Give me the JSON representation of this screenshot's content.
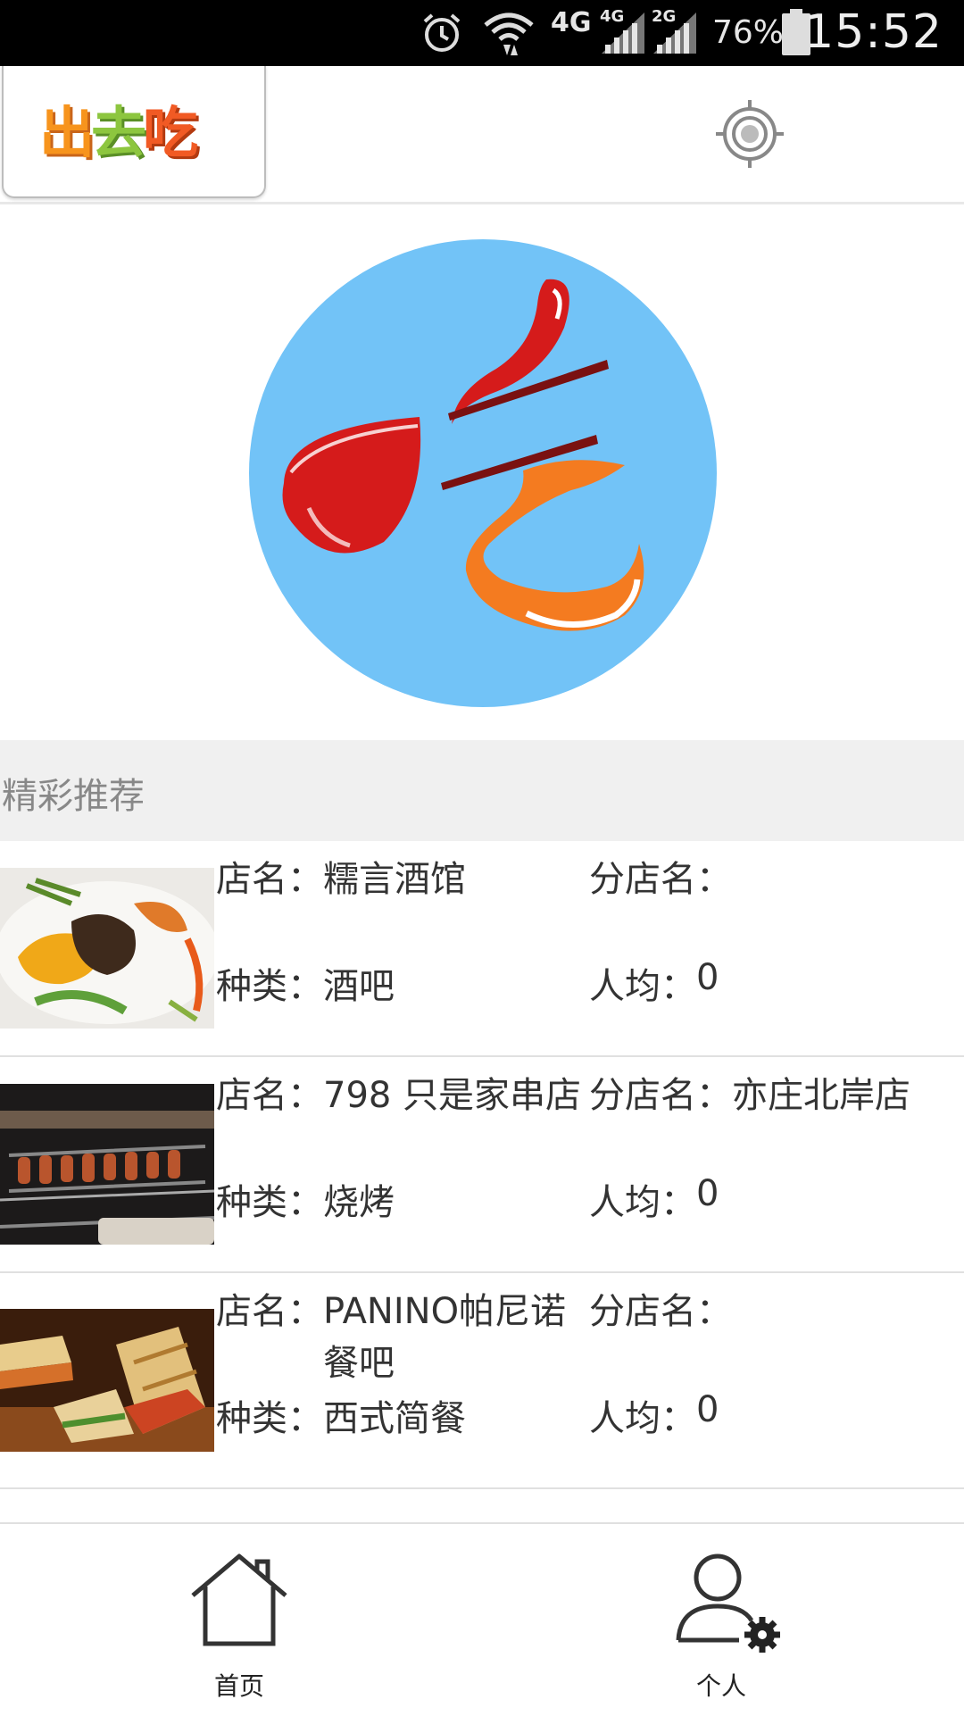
{
  "status_bar": {
    "time": "15:52",
    "battery": "76%",
    "network_1": "4G",
    "network_2": "4G",
    "network_3": "2G",
    "icons": [
      "alarm-icon",
      "wifi-icon",
      "signal-icon",
      "signal-icon",
      "battery-icon"
    ]
  },
  "header": {
    "logo_text": "出去吃",
    "logo_chars": [
      "出",
      "去",
      "吃"
    ],
    "logo_colors": [
      "#f7941d",
      "#8dc63f",
      "#f15a24"
    ],
    "locate_icon": "crosshair-icon"
  },
  "hero": {
    "logo_icon": "chi-logo-icon",
    "circle_color": "#72c3f7"
  },
  "section": {
    "title": "精彩推荐"
  },
  "shops": [
    {
      "name_label": "店名：",
      "name": "糯言酒馆",
      "branch_label": "分店名：",
      "branch": "",
      "category_label": "种类：",
      "category": "酒吧",
      "avg_label": "人均：",
      "avg": "0"
    },
    {
      "name_label": "店名：",
      "name": "798 只是家串店",
      "branch_label": "分店名：",
      "branch": "亦庄北岸店",
      "category_label": "种类：",
      "category": "烧烤",
      "avg_label": "人均：",
      "avg": "0"
    },
    {
      "name_label": "店名：",
      "name": "PANINO帕尼诺餐吧",
      "branch_label": "分店名：",
      "branch": "",
      "category_label": "种类：",
      "category": "西式简餐",
      "avg_label": "人均：",
      "avg": "0"
    }
  ],
  "bottom_nav": {
    "home_label": "首页",
    "profile_label": "个人",
    "home_icon": "home-icon",
    "profile_icon": "user-settings-icon"
  }
}
